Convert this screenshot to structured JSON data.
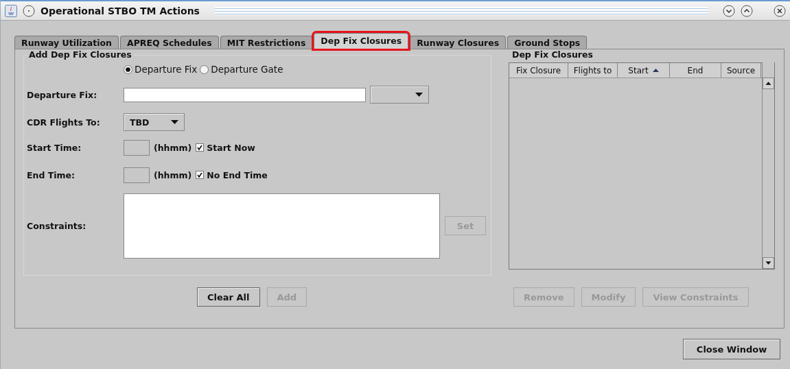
{
  "window": {
    "title": "Operational STBO TM Actions"
  },
  "tabs": [
    {
      "label": "Runway Utilization",
      "selected": false,
      "highlighted": false
    },
    {
      "label": "APREQ Schedules",
      "selected": false,
      "highlighted": false
    },
    {
      "label": "MIT Restrictions",
      "selected": false,
      "highlighted": false
    },
    {
      "label": "Dep Fix Closures",
      "selected": true,
      "highlighted": true
    },
    {
      "label": "Runway Closures",
      "selected": false,
      "highlighted": false
    },
    {
      "label": "Ground Stops",
      "selected": false,
      "highlighted": false
    }
  ],
  "add_panel": {
    "title": "Add Dep Fix Closures",
    "radios": [
      {
        "label": "Departure Fix",
        "selected": true
      },
      {
        "label": "Departure Gate",
        "selected": false
      }
    ],
    "departure_fix": {
      "label": "Departure Fix:"
    },
    "cdr_flights_to": {
      "label": "CDR Flights To:",
      "value": "TBD"
    },
    "start_time": {
      "label": "Start Time:",
      "unit": "(hhmm)",
      "checkbox": {
        "label": "Start Now",
        "checked": true
      }
    },
    "end_time": {
      "label": "End Time:",
      "unit": "(hhmm)",
      "checkbox": {
        "label": "No End Time",
        "checked": true
      }
    },
    "constraints": {
      "label": "Constraints:",
      "button": {
        "label": "Set",
        "disabled": true
      }
    },
    "buttons": [
      {
        "label": "Clear All",
        "disabled": false
      },
      {
        "label": "Add",
        "disabled": true
      }
    ]
  },
  "list_panel": {
    "title": "Dep Fix Closures",
    "table": {
      "columns": [
        {
          "label": "Fix Closure",
          "sorted": false
        },
        {
          "label": "Flights to",
          "sorted": false
        },
        {
          "label": "Start",
          "sorted": true
        },
        {
          "label": "End",
          "sorted": false
        },
        {
          "label": "Source",
          "sorted": false
        }
      ]
    },
    "buttons": [
      {
        "label": "Remove",
        "disabled": true
      },
      {
        "label": "Modify",
        "disabled": true
      },
      {
        "label": "View Constraints",
        "disabled": true
      }
    ]
  },
  "footer": {
    "button": {
      "label": "Close Window",
      "disabled": false
    }
  }
}
